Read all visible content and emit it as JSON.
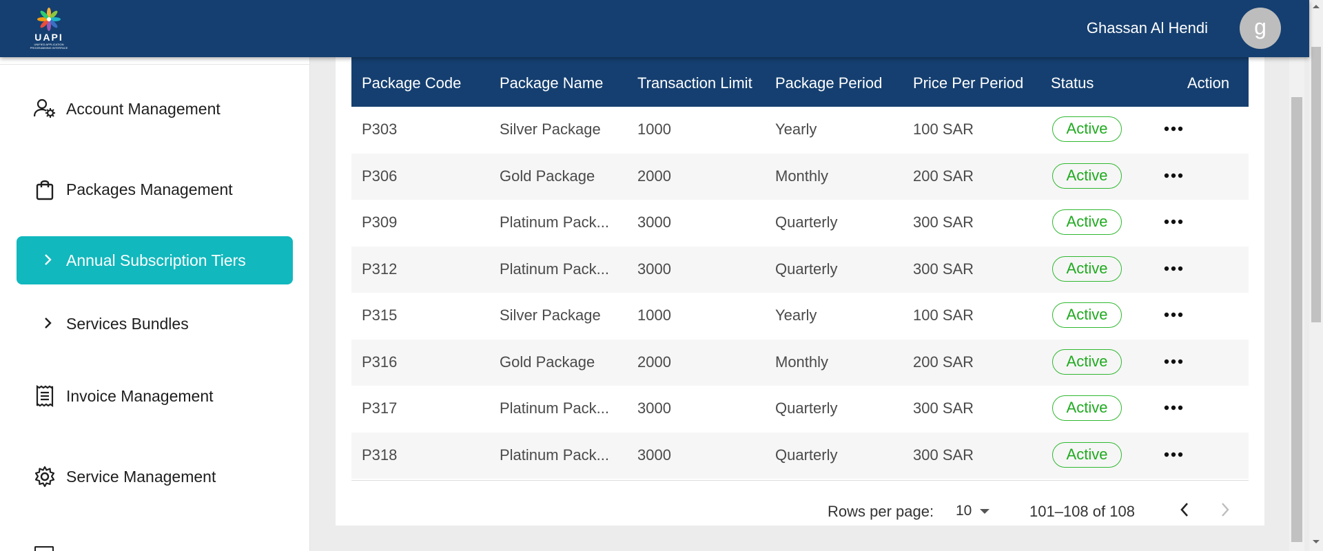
{
  "header": {
    "logo_text": "UAPI",
    "logo_subtitle": "UNIFIED APPLICATION PROGRAMMING INTERFACE",
    "user_name": "Ghassan Al Hendi",
    "avatar_letter": "g",
    "background_color": "#153f70"
  },
  "sidebar": {
    "items": [
      {
        "label": "Account Management",
        "icon": "account-settings-icon"
      },
      {
        "label": "Packages Management",
        "icon": "shopping-bag-icon"
      },
      {
        "label": "Annual Subscription Tiers",
        "icon": "chevron-right-icon",
        "active": true
      },
      {
        "label": "Services Bundles",
        "icon": "chevron-right-icon"
      },
      {
        "label": "Invoice Management",
        "icon": "receipt-icon"
      },
      {
        "label": "Service Management",
        "icon": "gear-icon"
      }
    ],
    "active_color": "#11b8bd"
  },
  "table": {
    "columns": [
      "Package Code",
      "Package Name",
      "Transaction Limit",
      "Package Period",
      "Price Per Period",
      "Status",
      "Action"
    ],
    "rows": [
      {
        "code": "P303",
        "name": "Silver Package",
        "limit": "1000",
        "period": "Yearly",
        "price": "100 SAR",
        "status": "Active"
      },
      {
        "code": "P306",
        "name": "Gold Package",
        "limit": "2000",
        "period": "Monthly",
        "price": "200 SAR",
        "status": "Active"
      },
      {
        "code": "P309",
        "name": "Platinum Pack...",
        "limit": "3000",
        "period": "Quarterly",
        "price": "300 SAR",
        "status": "Active"
      },
      {
        "code": "P312",
        "name": "Platinum Pack...",
        "limit": "3000",
        "period": "Quarterly",
        "price": "300 SAR",
        "status": "Active"
      },
      {
        "code": "P315",
        "name": "Silver Package",
        "limit": "1000",
        "period": "Yearly",
        "price": "100 SAR",
        "status": "Active"
      },
      {
        "code": "P316",
        "name": "Gold Package",
        "limit": "2000",
        "period": "Monthly",
        "price": "200 SAR",
        "status": "Active"
      },
      {
        "code": "P317",
        "name": "Platinum Pack...",
        "limit": "3000",
        "period": "Quarterly",
        "price": "300 SAR",
        "status": "Active"
      },
      {
        "code": "P318",
        "name": "Platinum Pack...",
        "limit": "3000",
        "period": "Quarterly",
        "price": "300 SAR",
        "status": "Active"
      }
    ],
    "status_color": "#1faa1f"
  },
  "pagination": {
    "rows_per_page_label": "Rows per page:",
    "rows_per_page_value": "10",
    "range_label": "101–108 of 108"
  }
}
